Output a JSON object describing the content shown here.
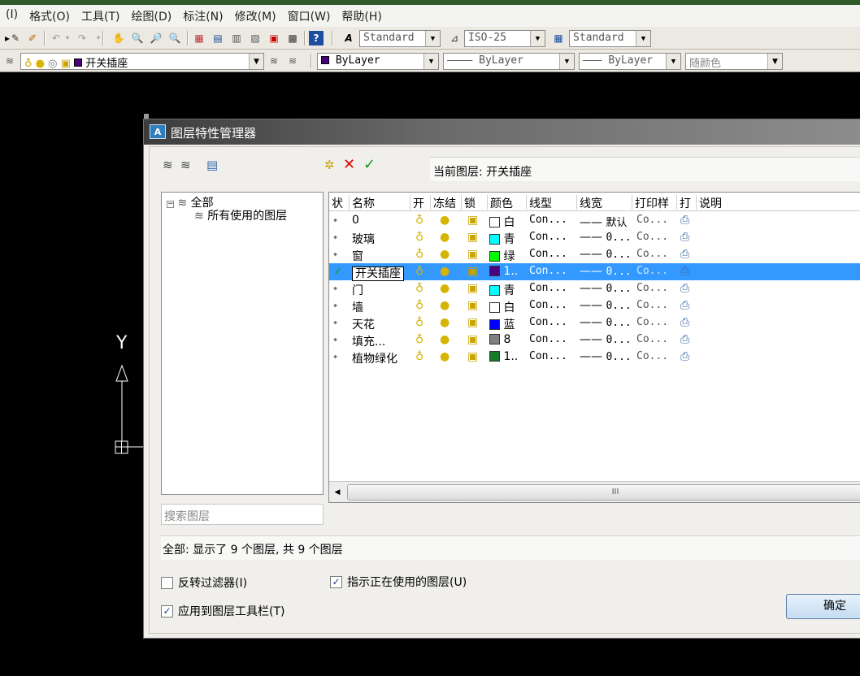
{
  "menu": [
    "(I)",
    "格式(O)",
    "工具(T)",
    "绘图(D)",
    "标注(N)",
    "修改(M)",
    "窗口(W)",
    "帮助(H)"
  ],
  "toolbar": {
    "text_style": "Standard",
    "dim_style": "ISO-25",
    "table_style": "Standard",
    "layer_combo": "开关插座",
    "color_combo": "ByLayer",
    "linetype_combo": "ByLayer",
    "lineweight_combo": "ByLayer",
    "plotstyle_combo": "随颜色"
  },
  "dialog": {
    "title": "图层特性管理器",
    "current_layer_label": "当前图层: 开关插座",
    "tree": {
      "root": "全部",
      "child": "所有使用的图层"
    },
    "search_placeholder": "搜索图层",
    "columns": [
      "状",
      "名称",
      "开",
      "冻结",
      "锁",
      "颜色",
      "线型",
      "线宽",
      "打印样",
      "打",
      "说明"
    ],
    "layers": [
      {
        "name": "0",
        "color_name": "白",
        "color": "#ffffff",
        "linetype": "Con...",
        "lineweight": "默认",
        "plotstyle": "Co...",
        "current": false
      },
      {
        "name": "玻璃",
        "color_name": "青",
        "color": "#00ffff",
        "linetype": "Con...",
        "lineweight": "0...",
        "plotstyle": "Co...",
        "current": false
      },
      {
        "name": "窗",
        "color_name": "绿",
        "color": "#00ff00",
        "linetype": "Con...",
        "lineweight": "0...",
        "plotstyle": "Co...",
        "current": false
      },
      {
        "name": "开关插座",
        "color_name": "1..",
        "color": "#4b0082",
        "linetype": "Con...",
        "lineweight": "0...",
        "plotstyle": "Co...",
        "current": true
      },
      {
        "name": "门",
        "color_name": "青",
        "color": "#00ffff",
        "linetype": "Con...",
        "lineweight": "0...",
        "plotstyle": "Co...",
        "current": false
      },
      {
        "name": "墙",
        "color_name": "白",
        "color": "#ffffff",
        "linetype": "Con...",
        "lineweight": "0...",
        "plotstyle": "Co...",
        "current": false
      },
      {
        "name": "天花",
        "color_name": "蓝",
        "color": "#0000ff",
        "linetype": "Con...",
        "lineweight": "0...",
        "plotstyle": "Co...",
        "current": false
      },
      {
        "name": "填充...",
        "color_name": "8",
        "color": "#808080",
        "linetype": "Con...",
        "lineweight": "0...",
        "plotstyle": "Co...",
        "current": false
      },
      {
        "name": "植物绿化",
        "color_name": "1..",
        "color": "#1b7a2a",
        "linetype": "Con...",
        "lineweight": "0...",
        "plotstyle": "Co...",
        "current": false
      }
    ],
    "status_text": "全部: 显示了 9 个图层, 共 9 个图层",
    "invert_filter_label": "反转过滤器(I)",
    "apply_toolbar_label": "应用到图层工具栏(T)",
    "indicate_in_use_label": "指示正在使用的图层(U)",
    "ok_label": "确定",
    "scroll_grip": "III"
  },
  "ucs_label": "Y"
}
